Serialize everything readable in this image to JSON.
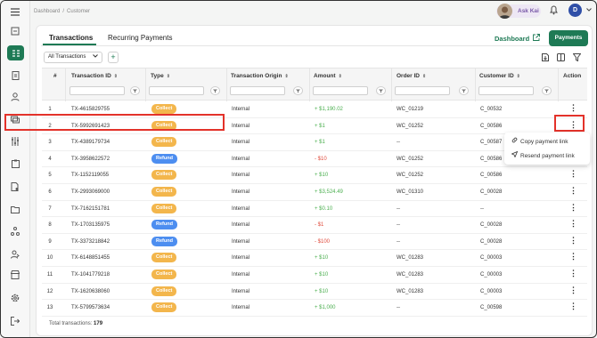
{
  "breadcrumb": {
    "parent": "Dashboard",
    "current": "Customer"
  },
  "header": {
    "ask_kai": "Ask Kai",
    "user_initial": "D"
  },
  "tabs": [
    {
      "label": "Transactions"
    },
    {
      "label": "Recurring Payments"
    }
  ],
  "actions": {
    "dashboard_link": "Dashboard",
    "payments_button": "Payments"
  },
  "filter": {
    "selected": "All Transactions",
    "add_label": "+"
  },
  "table": {
    "columns": [
      "#",
      "Transaction ID",
      "Type",
      "Transaction Origin",
      "Amount",
      "Order ID",
      "Customer ID",
      "Action"
    ],
    "rows": [
      {
        "n": "1",
        "id": "TX-4615829755",
        "type": "Collect",
        "origin": "Internal",
        "amount": "+ $1,190.02",
        "order": "WC_01219",
        "customer": "C_00532"
      },
      {
        "n": "2",
        "id": "TX-5992691423",
        "type": "Collect",
        "origin": "Internal",
        "amount": "+ $1",
        "order": "WC_01252",
        "customer": "C_00586"
      },
      {
        "n": "3",
        "id": "TX-4389179734",
        "type": "Collect",
        "origin": "Internal",
        "amount": "+ $1",
        "order": "--",
        "customer": "C_00587"
      },
      {
        "n": "4",
        "id": "TX-3958622572",
        "type": "Refund",
        "origin": "Internal",
        "amount": "- $10",
        "order": "WC_01252",
        "customer": "C_00586"
      },
      {
        "n": "5",
        "id": "TX-1152119055",
        "type": "Collect",
        "origin": "Internal",
        "amount": "+ $10",
        "order": "WC_01252",
        "customer": "C_00586"
      },
      {
        "n": "6",
        "id": "TX-2993069000",
        "type": "Collect",
        "origin": "Internal",
        "amount": "+ $3,524.49",
        "order": "WC_01310",
        "customer": "C_00028"
      },
      {
        "n": "7",
        "id": "TX-7162151781",
        "type": "Collect",
        "origin": "Internal",
        "amount": "+ $0.10",
        "order": "--",
        "customer": "--"
      },
      {
        "n": "8",
        "id": "TX-1703135975",
        "type": "Refund",
        "origin": "Internal",
        "amount": "- $1",
        "order": "--",
        "customer": "C_00028"
      },
      {
        "n": "9",
        "id": "TX-3373218842",
        "type": "Refund",
        "origin": "Internal",
        "amount": "- $100",
        "order": "--",
        "customer": "C_00028"
      },
      {
        "n": "10",
        "id": "TX-6148851455",
        "type": "Collect",
        "origin": "Internal",
        "amount": "+ $10",
        "order": "WC_01283",
        "customer": "C_00003"
      },
      {
        "n": "11",
        "id": "TX-1041779218",
        "type": "Collect",
        "origin": "Internal",
        "amount": "+ $10",
        "order": "WC_01283",
        "customer": "C_00003"
      },
      {
        "n": "12",
        "id": "TX-1620638060",
        "type": "Collect",
        "origin": "Internal",
        "amount": "+ $10",
        "order": "WC_01283",
        "customer": "C_00003"
      },
      {
        "n": "13",
        "id": "TX-5799573634",
        "type": "Collect",
        "origin": "Internal",
        "amount": "+ $1,000",
        "order": "--",
        "customer": "C_00598"
      }
    ]
  },
  "context_menu": {
    "copy": "Copy payment link",
    "resend": "Resend payment link"
  },
  "footer": {
    "label": "Total transactions:",
    "count": "179"
  },
  "colors": {
    "brand": "#1e7a55",
    "collect": "#f3b64c",
    "refund": "#4d8ef0",
    "positive": "#4caf50",
    "negative": "#e04a3b",
    "highlight": "#e3322a"
  }
}
